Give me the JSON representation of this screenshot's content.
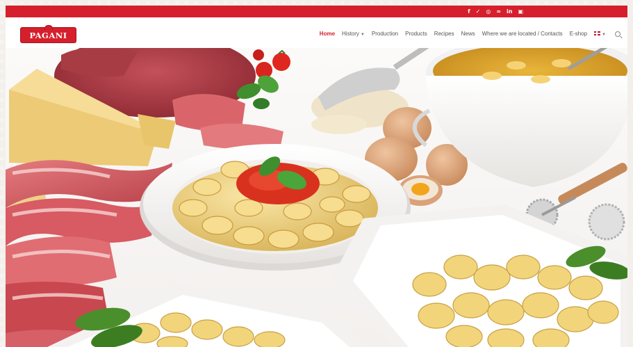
{
  "brand": {
    "logo_text": "PAGANI"
  },
  "social": [
    {
      "icon": "facebook-icon",
      "glyph": "f"
    },
    {
      "icon": "twitter-icon",
      "glyph": "✓"
    },
    {
      "icon": "instagram-icon",
      "glyph": "◎"
    },
    {
      "icon": "rss-icon",
      "glyph": "≈"
    },
    {
      "icon": "linkedin-icon",
      "glyph": "in"
    },
    {
      "icon": "youtube-icon",
      "glyph": "▣"
    }
  ],
  "nav": {
    "home": "Home",
    "history": "History",
    "production": "Production",
    "products": "Products",
    "recipes": "Recipes",
    "news": "News",
    "where": "Where we are located / Contacts",
    "eshop": "E-shop"
  },
  "colors": {
    "brand_red": "#d61f2c",
    "nav_text": "#555555"
  },
  "hero": {
    "image": "food-spread-photo"
  }
}
